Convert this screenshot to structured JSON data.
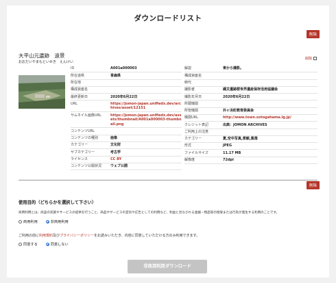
{
  "page_title": "ダウンロードリスト",
  "delete_label": "削除",
  "item": {
    "title": "大平山元遺跡　遠景",
    "kana": "おおだいやまもといせき　えんけい",
    "delete_check_label": "削除",
    "left_rows": [
      {
        "key": "ID",
        "value": "A001a000003"
      },
      {
        "key": "所在道県",
        "value": "青森県"
      },
      {
        "key": "所在地",
        "value": ""
      },
      {
        "key": "構成資産名",
        "value": ""
      },
      {
        "key": "最終更新日",
        "value": "2020年6月22日"
      },
      {
        "key": "URL",
        "value": "https://jomon-japan.unifiedx.dev/archives/asset/12151",
        "link": true
      },
      {
        "key": "サムネイル画像URL",
        "value": "https://jomon-japan.unifiedx.dev/assets/thumbnail/A001a000003-thumbnail.png",
        "link": true
      },
      {
        "key": "コンテンツURL",
        "value": ""
      },
      {
        "key": "コンテンツの種別",
        "value": "画像"
      },
      {
        "key": "カテゴリー",
        "value": "文化財"
      },
      {
        "key": "サブカテゴリー",
        "value": "考古学"
      },
      {
        "key": "ライセンス",
        "value": "CC BY",
        "link": true
      },
      {
        "key": "コンテンツ公開状況",
        "value": "ウェブ公開"
      }
    ],
    "right_rows": [
      {
        "key": "解説",
        "value": "東から撮影。"
      },
      {
        "key": "構成資産名",
        "value": ""
      },
      {
        "key": "時代",
        "value": ""
      },
      {
        "key": "撮影者",
        "value": "縄文遺跡群世界遺産保存活用協議会"
      },
      {
        "key": "撮影年月日",
        "value": "2020年6月22日"
      },
      {
        "key": "所蔵機関",
        "value": ""
      },
      {
        "key": "所管機関",
        "value": "外ヶ浜町教育委員会"
      },
      {
        "key": "機関URL",
        "value": "http://www.town.sotogahama.lg.jp/",
        "link": true
      },
      {
        "key": "クレジット表記",
        "value": "出典：JOMON ARCHIVES"
      },
      {
        "key": "ご利用上の注意",
        "value": ""
      },
      {
        "key": "カテゴリー",
        "value": "夏,空中写真,景観,集落"
      },
      {
        "key": "形式",
        "value": "JPEG"
      },
      {
        "key": "ファイルサイズ",
        "value": "11.17 MB"
      },
      {
        "key": "解像度",
        "value": "72dpi"
      }
    ]
  },
  "purpose": {
    "title": "使用目的（どちらかを選択して下さい）",
    "notice": "商用利用とは、商品の売買やサービスの提供を行うこと、商品やサービスの宣伝や広告としての利用など、利益と見なされる金銭・物品等の授受または行為が発生する利用のことです。",
    "commercial": "商用利用",
    "noncommercial": "非商用利用",
    "selected": "noncommercial"
  },
  "terms": {
    "pre": "ご利用の前に",
    "terms_link": "利用規約",
    "mid": "及び",
    "privacy_link": "プライバシーポリシー",
    "post": "をお読みいただき、内容に同意していただける方のみ利用できます。",
    "agree": "同意する",
    "disagree": "同意しない",
    "selected": "disagree"
  },
  "download_button": "非商用利用ダウンロード",
  "colors": {
    "accent": "#b4352a",
    "radio": "#1e66d0",
    "disabled_button": "#c4c4c4"
  }
}
